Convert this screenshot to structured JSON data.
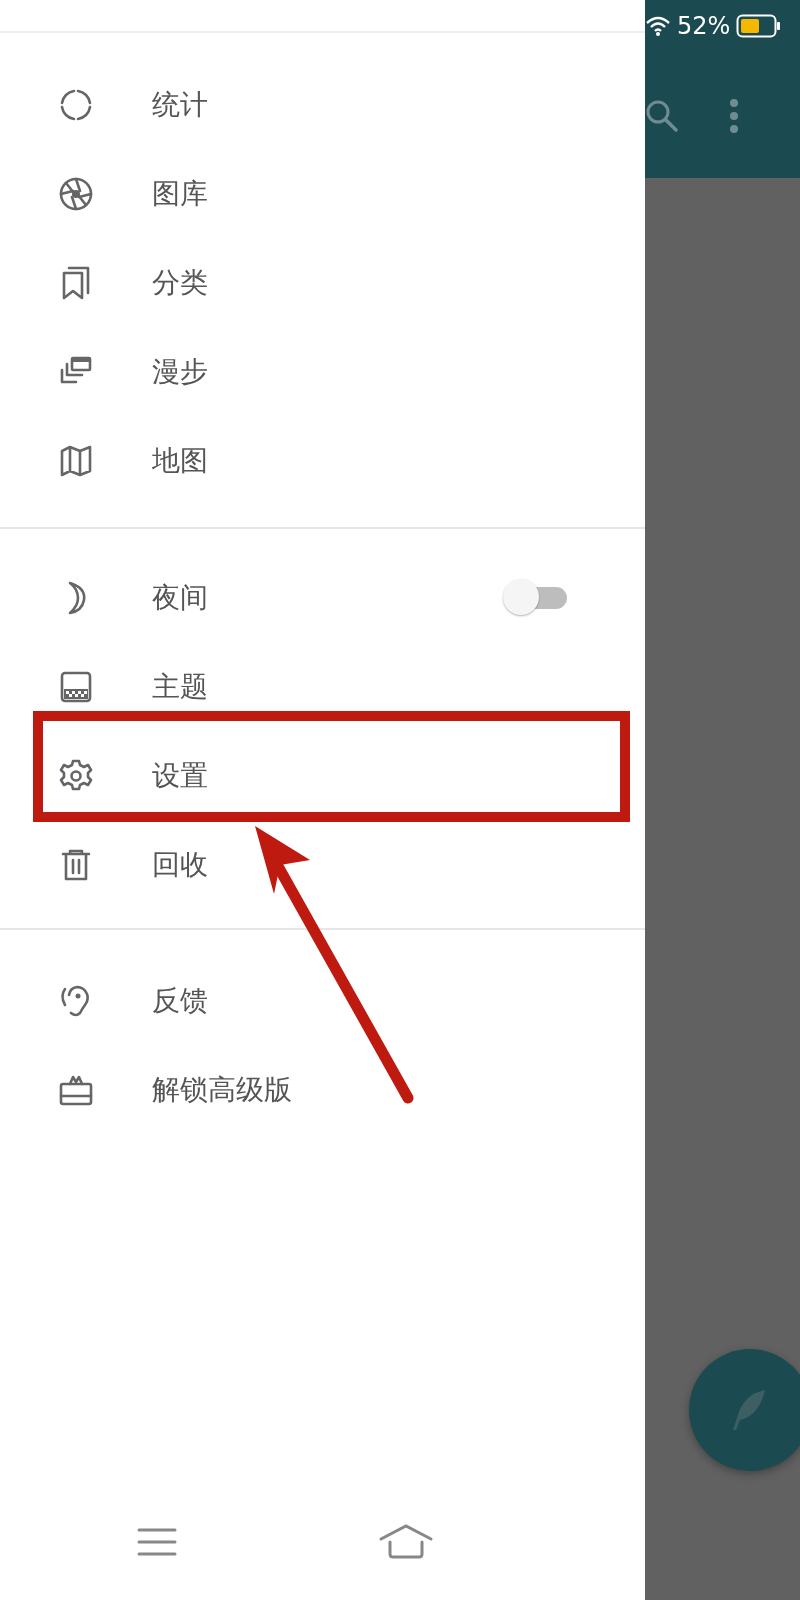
{
  "status_bar": {
    "battery": "52%"
  },
  "drawer": {
    "sections": [
      {
        "items": [
          {
            "kind": "link",
            "label": "统计",
            "highlighted": false
          },
          {
            "kind": "link",
            "label": "图库",
            "highlighted": false
          },
          {
            "kind": "link",
            "label": "分类",
            "highlighted": false
          },
          {
            "kind": "link",
            "label": "漫步",
            "highlighted": false
          },
          {
            "kind": "link",
            "label": "地图",
            "highlighted": false
          }
        ]
      },
      {
        "items": [
          {
            "kind": "toggle",
            "label": "夜间",
            "on": false,
            "highlighted": false
          },
          {
            "kind": "link",
            "label": "主题",
            "highlighted": false
          },
          {
            "kind": "link",
            "label": "设置",
            "highlighted": true
          },
          {
            "kind": "link",
            "label": "回收",
            "highlighted": false
          }
        ]
      },
      {
        "items": [
          {
            "kind": "link",
            "label": "反馈",
            "highlighted": false
          },
          {
            "kind": "link",
            "label": "解锁高级版",
            "highlighted": false
          }
        ]
      }
    ]
  }
}
